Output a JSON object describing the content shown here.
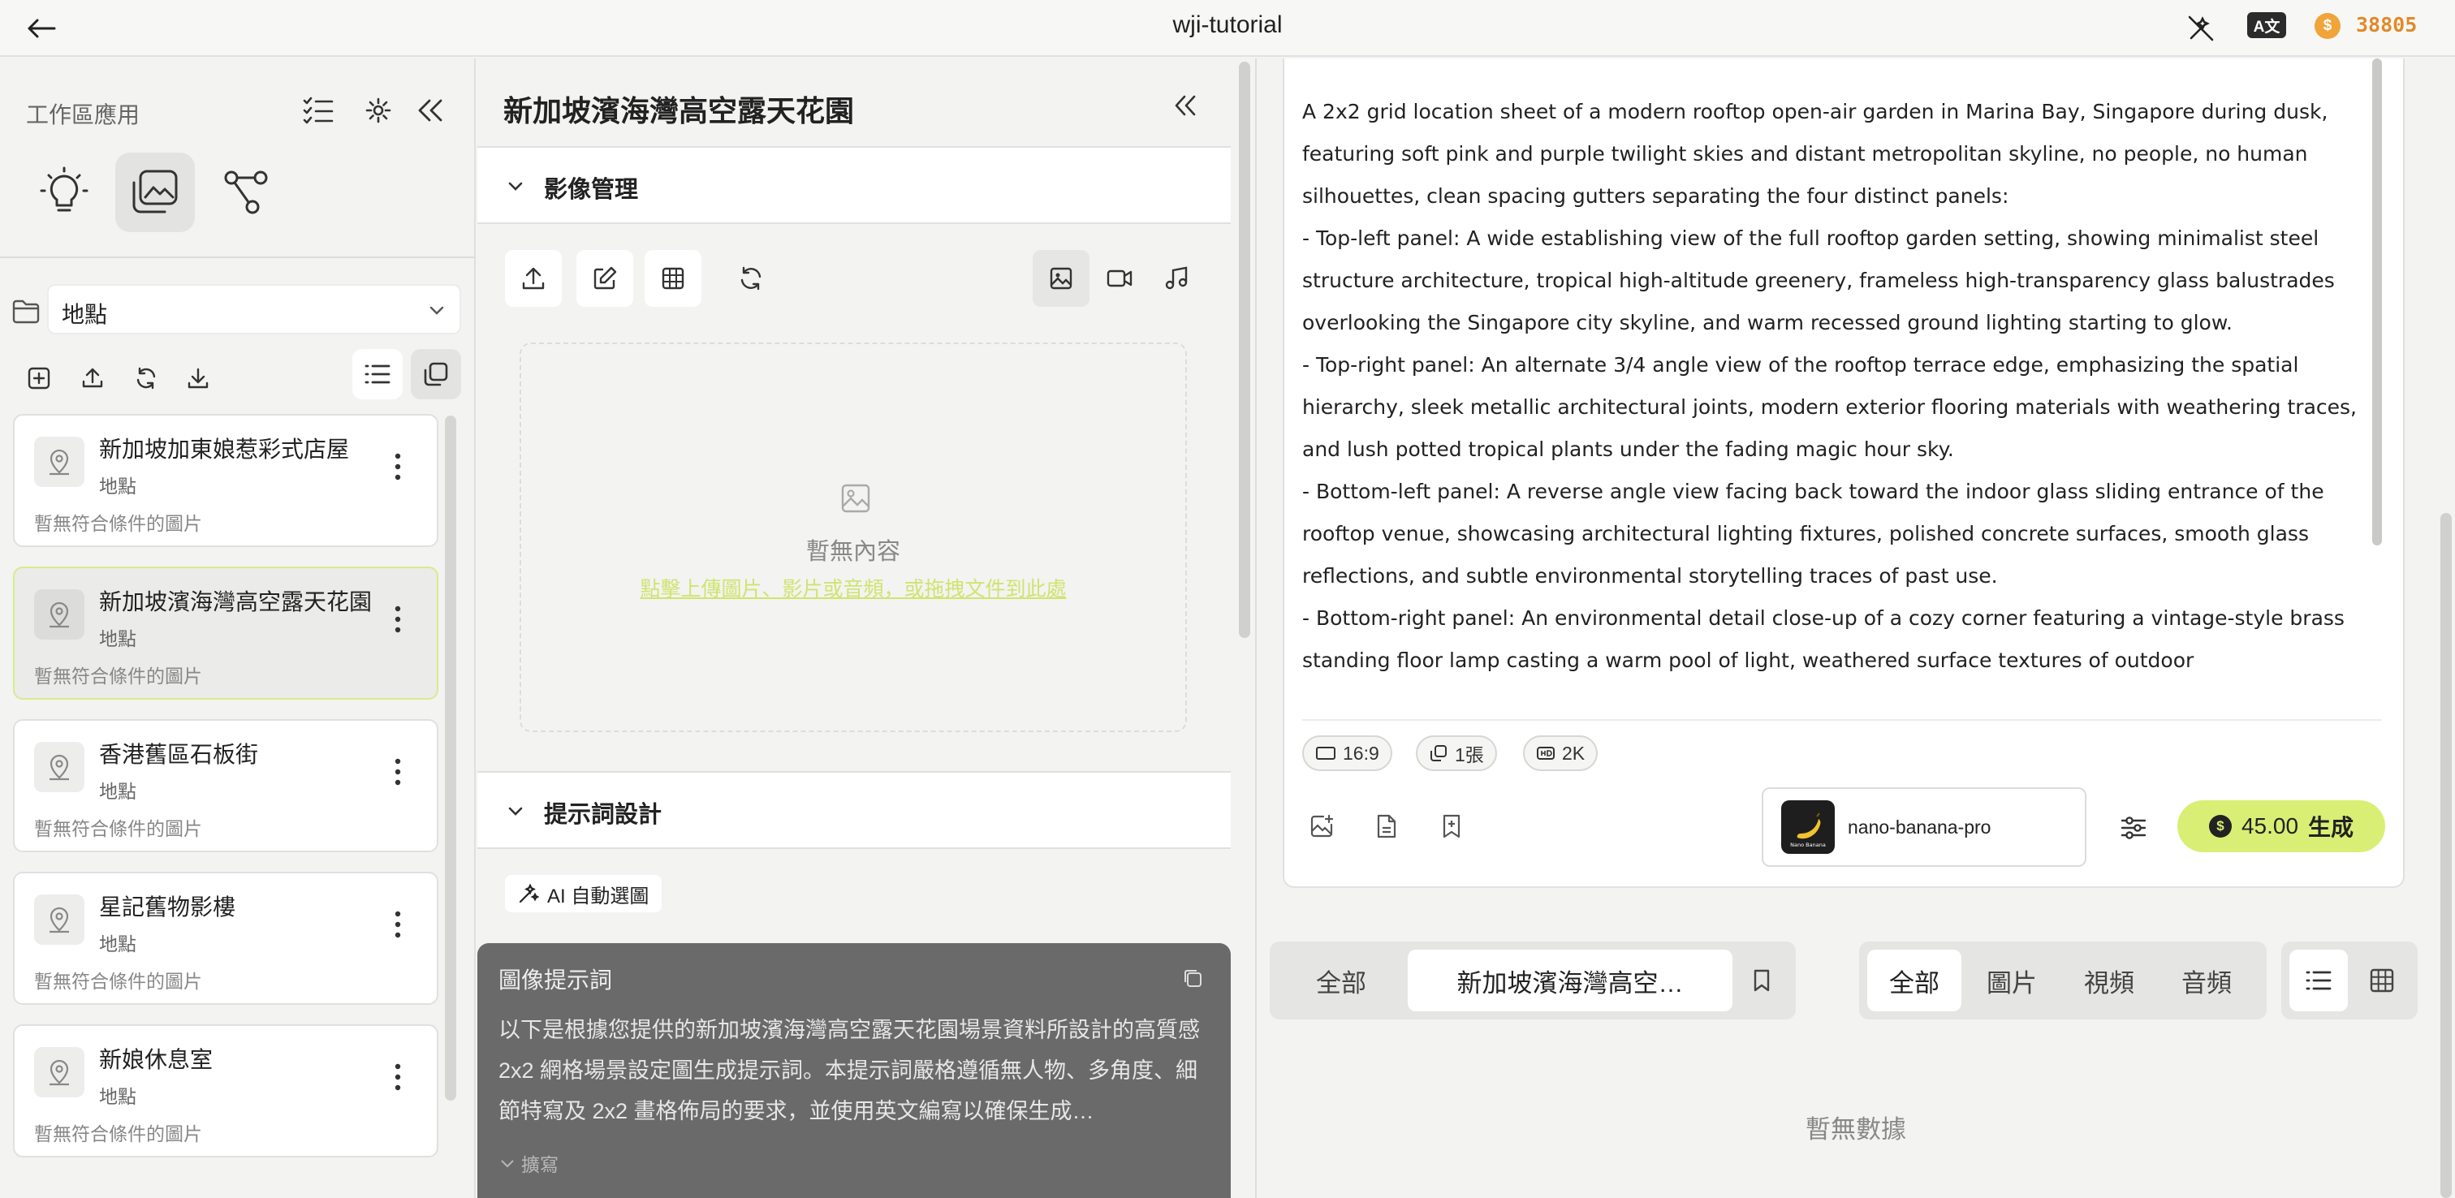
{
  "app": {
    "title": "wji-tutorial",
    "credits": "38805",
    "lang_badge": "A文",
    "coin_symbol": "$"
  },
  "sidebar": {
    "title": "工作區應用",
    "category": "地點",
    "items": [
      {
        "name": "新加坡加東娘惹彩式店屋",
        "type": "地點",
        "status": "暫無符合條件的圖片"
      },
      {
        "name": "新加坡濱海灣高空露天花園",
        "type": "地點",
        "status": "暫無符合條件的圖片"
      },
      {
        "name": "香港舊區石板街",
        "type": "地點",
        "status": "暫無符合條件的圖片"
      },
      {
        "name": "星記舊物影樓",
        "type": "地點",
        "status": "暫無符合條件的圖片"
      },
      {
        "name": "新娘休息室",
        "type": "地點",
        "status": "暫無符合條件的圖片"
      }
    ]
  },
  "middle": {
    "title": "新加坡濱海灣高空露天花園",
    "image_section": "影像管理",
    "empty_title": "暫無內容",
    "empty_link": "點擊上傳圖片、影片或音頻，或拖拽文件到此處",
    "prompt_section": "提示詞設計",
    "ai_button": "AI 自動選圖",
    "prompt_box_title": "圖像提示詞",
    "prompt_box_text": "以下是根據您提供的新加坡濱海灣高空露天花園場景資料所設計的高質感 2x2 網格場景設定圖生成提示詞。本提示詞嚴格遵循無人物、多角度、細節特寫及 2x2 畫格佈局的要求，並使用英文編寫以確保生成…",
    "expand_label": "擴寫"
  },
  "generator": {
    "prompt_lines": [
      "A 2x2 grid location sheet of a modern rooftop open-air garden in Marina Bay, Singapore during dusk, featuring soft pink and purple twilight skies and distant metropolitan skyline, no people, no human silhouettes, clean spacing gutters separating the four distinct panels:",
      "- Top-left panel: A wide establishing view of the full rooftop garden setting, showing minimalist steel structure architecture, tropical high-altitude greenery, frameless high-transparency glass balustrades overlooking the Singapore city skyline, and warm recessed ground lighting starting to glow.",
      "- Top-right panel: An alternate 3/4 angle view of the rooftop terrace edge, emphasizing the spatial hierarchy, sleek metallic architectural joints, modern exterior flooring materials with weathering traces, and lush potted tropical plants under the fading magic hour sky.",
      "- Bottom-left panel: A reverse angle view facing back toward the indoor glass sliding entrance of the rooftop venue, showcasing architectural lighting fixtures, polished concrete surfaces, smooth glass reflections, and subtle environmental storytelling traces of past use.",
      "- Bottom-right panel: An environmental detail close-up of a cozy corner featuring a vintage-style brass standing floor lamp casting a warm pool of light, weathered surface textures of outdoor"
    ],
    "chips": {
      "ratio": "16:9",
      "count": "1張",
      "resolution": "2K"
    },
    "model": "nano-banana-pro",
    "model_logo_text": "Nano Banana",
    "cost": "45.00",
    "generate_label": "生成"
  },
  "filters": {
    "scope_all": "全部",
    "scope_current": "新加坡濱海灣高空…",
    "media": [
      "全部",
      "圖片",
      "視頻",
      "音頻"
    ]
  },
  "empty_data": "暫無數據",
  "colors": {
    "accent": "#d9ee74",
    "credits": "#e08a2a",
    "link": "#cfe46f"
  }
}
